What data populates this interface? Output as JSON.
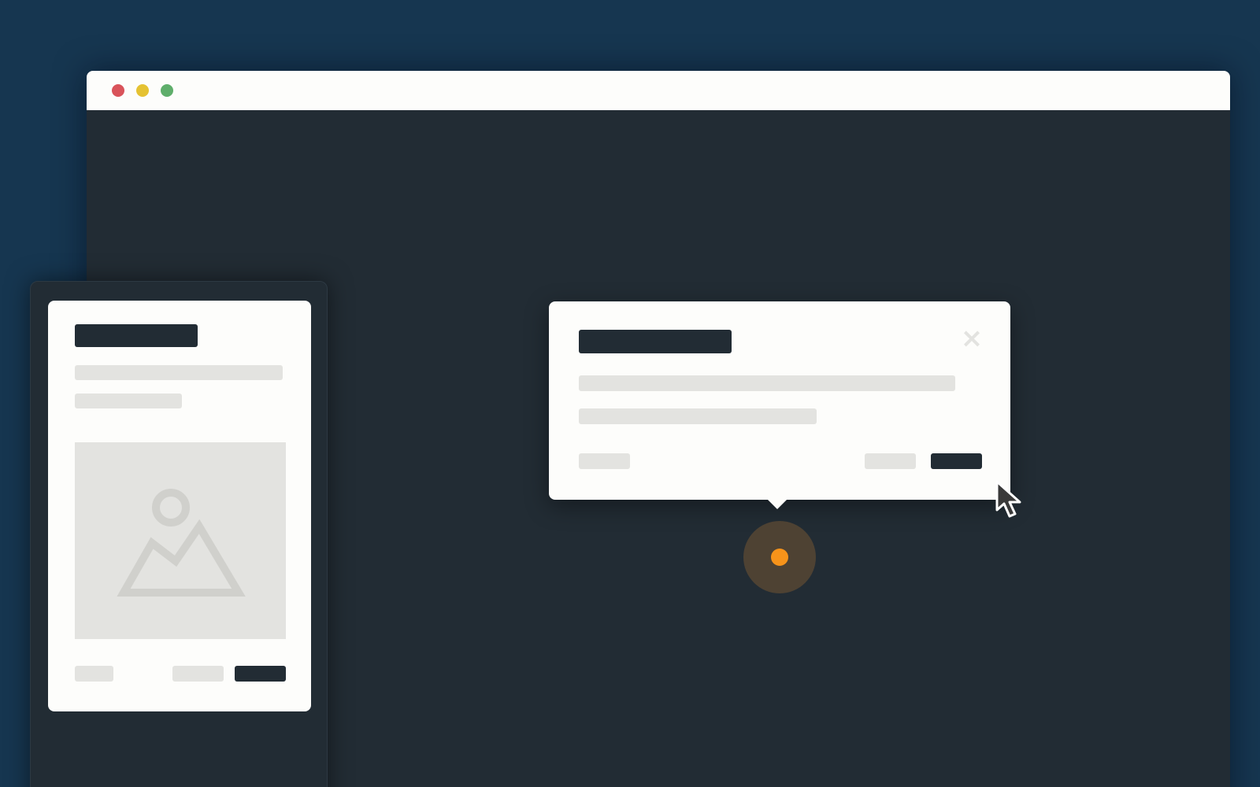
{
  "window": {
    "controls": [
      "close",
      "minimize",
      "maximize"
    ],
    "colors": {
      "close": "#d9535a",
      "minimize": "#e5c232",
      "maximize": "#5fae6b"
    }
  },
  "dialog": {
    "close_icon": "close-icon"
  },
  "hotspot": {
    "accent_color": "#f7931a"
  },
  "mobile_card": {
    "image_icon": "image-placeholder-icon"
  },
  "cursor": {
    "icon": "pointer-cursor-icon"
  }
}
